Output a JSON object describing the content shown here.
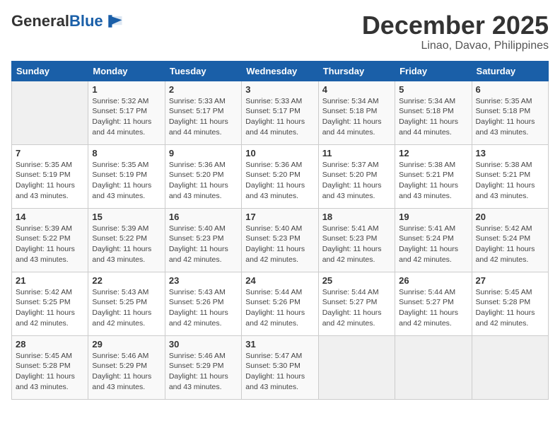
{
  "header": {
    "logo_general": "General",
    "logo_blue": "Blue",
    "month": "December 2025",
    "location": "Linao, Davao, Philippines"
  },
  "weekdays": [
    "Sunday",
    "Monday",
    "Tuesday",
    "Wednesday",
    "Thursday",
    "Friday",
    "Saturday"
  ],
  "weeks": [
    [
      {
        "day": "",
        "info": ""
      },
      {
        "day": "1",
        "info": "Sunrise: 5:32 AM\nSunset: 5:17 PM\nDaylight: 11 hours and 44 minutes."
      },
      {
        "day": "2",
        "info": "Sunrise: 5:33 AM\nSunset: 5:17 PM\nDaylight: 11 hours and 44 minutes."
      },
      {
        "day": "3",
        "info": "Sunrise: 5:33 AM\nSunset: 5:17 PM\nDaylight: 11 hours and 44 minutes."
      },
      {
        "day": "4",
        "info": "Sunrise: 5:34 AM\nSunset: 5:18 PM\nDaylight: 11 hours and 44 minutes."
      },
      {
        "day": "5",
        "info": "Sunrise: 5:34 AM\nSunset: 5:18 PM\nDaylight: 11 hours and 44 minutes."
      },
      {
        "day": "6",
        "info": "Sunrise: 5:35 AM\nSunset: 5:18 PM\nDaylight: 11 hours and 43 minutes."
      }
    ],
    [
      {
        "day": "7",
        "info": "Sunrise: 5:35 AM\nSunset: 5:19 PM\nDaylight: 11 hours and 43 minutes."
      },
      {
        "day": "8",
        "info": "Sunrise: 5:35 AM\nSunset: 5:19 PM\nDaylight: 11 hours and 43 minutes."
      },
      {
        "day": "9",
        "info": "Sunrise: 5:36 AM\nSunset: 5:20 PM\nDaylight: 11 hours and 43 minutes."
      },
      {
        "day": "10",
        "info": "Sunrise: 5:36 AM\nSunset: 5:20 PM\nDaylight: 11 hours and 43 minutes."
      },
      {
        "day": "11",
        "info": "Sunrise: 5:37 AM\nSunset: 5:20 PM\nDaylight: 11 hours and 43 minutes."
      },
      {
        "day": "12",
        "info": "Sunrise: 5:38 AM\nSunset: 5:21 PM\nDaylight: 11 hours and 43 minutes."
      },
      {
        "day": "13",
        "info": "Sunrise: 5:38 AM\nSunset: 5:21 PM\nDaylight: 11 hours and 43 minutes."
      }
    ],
    [
      {
        "day": "14",
        "info": "Sunrise: 5:39 AM\nSunset: 5:22 PM\nDaylight: 11 hours and 43 minutes."
      },
      {
        "day": "15",
        "info": "Sunrise: 5:39 AM\nSunset: 5:22 PM\nDaylight: 11 hours and 43 minutes."
      },
      {
        "day": "16",
        "info": "Sunrise: 5:40 AM\nSunset: 5:23 PM\nDaylight: 11 hours and 42 minutes."
      },
      {
        "day": "17",
        "info": "Sunrise: 5:40 AM\nSunset: 5:23 PM\nDaylight: 11 hours and 42 minutes."
      },
      {
        "day": "18",
        "info": "Sunrise: 5:41 AM\nSunset: 5:23 PM\nDaylight: 11 hours and 42 minutes."
      },
      {
        "day": "19",
        "info": "Sunrise: 5:41 AM\nSunset: 5:24 PM\nDaylight: 11 hours and 42 minutes."
      },
      {
        "day": "20",
        "info": "Sunrise: 5:42 AM\nSunset: 5:24 PM\nDaylight: 11 hours and 42 minutes."
      }
    ],
    [
      {
        "day": "21",
        "info": "Sunrise: 5:42 AM\nSunset: 5:25 PM\nDaylight: 11 hours and 42 minutes."
      },
      {
        "day": "22",
        "info": "Sunrise: 5:43 AM\nSunset: 5:25 PM\nDaylight: 11 hours and 42 minutes."
      },
      {
        "day": "23",
        "info": "Sunrise: 5:43 AM\nSunset: 5:26 PM\nDaylight: 11 hours and 42 minutes."
      },
      {
        "day": "24",
        "info": "Sunrise: 5:44 AM\nSunset: 5:26 PM\nDaylight: 11 hours and 42 minutes."
      },
      {
        "day": "25",
        "info": "Sunrise: 5:44 AM\nSunset: 5:27 PM\nDaylight: 11 hours and 42 minutes."
      },
      {
        "day": "26",
        "info": "Sunrise: 5:44 AM\nSunset: 5:27 PM\nDaylight: 11 hours and 42 minutes."
      },
      {
        "day": "27",
        "info": "Sunrise: 5:45 AM\nSunset: 5:28 PM\nDaylight: 11 hours and 42 minutes."
      }
    ],
    [
      {
        "day": "28",
        "info": "Sunrise: 5:45 AM\nSunset: 5:28 PM\nDaylight: 11 hours and 43 minutes."
      },
      {
        "day": "29",
        "info": "Sunrise: 5:46 AM\nSunset: 5:29 PM\nDaylight: 11 hours and 43 minutes."
      },
      {
        "day": "30",
        "info": "Sunrise: 5:46 AM\nSunset: 5:29 PM\nDaylight: 11 hours and 43 minutes."
      },
      {
        "day": "31",
        "info": "Sunrise: 5:47 AM\nSunset: 5:30 PM\nDaylight: 11 hours and 43 minutes."
      },
      {
        "day": "",
        "info": ""
      },
      {
        "day": "",
        "info": ""
      },
      {
        "day": "",
        "info": ""
      }
    ]
  ]
}
